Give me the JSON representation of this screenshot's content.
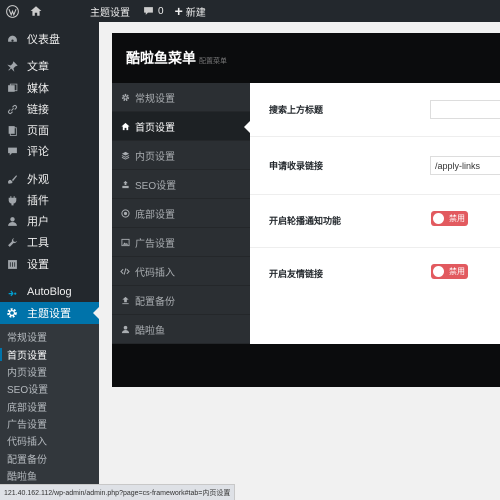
{
  "adminbar": {
    "site_name": "主题设置",
    "comments_count": "0",
    "new_label": "新建"
  },
  "sidebar": {
    "items": [
      {
        "label": "仪表盘",
        "icon": "dashboard-icon"
      },
      {
        "label": "文章",
        "icon": "pin-icon"
      },
      {
        "label": "媒体",
        "icon": "media-icon"
      },
      {
        "label": "链接",
        "icon": "link-icon"
      },
      {
        "label": "页面",
        "icon": "page-icon"
      },
      {
        "label": "评论",
        "icon": "comment-icon"
      },
      {
        "label": "外观",
        "icon": "brush-icon"
      },
      {
        "label": "插件",
        "icon": "plugin-icon"
      },
      {
        "label": "用户",
        "icon": "user-icon"
      },
      {
        "label": "工具",
        "icon": "wrench-icon"
      },
      {
        "label": "设置",
        "icon": "settings-icon"
      },
      {
        "label": "AutoBlog",
        "icon": "autoblog-icon"
      },
      {
        "label": "主题设置",
        "icon": "gear-icon"
      }
    ],
    "submenu": [
      "常规设置",
      "首页设置",
      "内页设置",
      "SEO设置",
      "底部设置",
      "广告设置",
      "代码插入",
      "配置备份",
      "酷啦鱼"
    ]
  },
  "panel": {
    "title": "酷啦鱼菜单",
    "subtitle": "配置菜单",
    "nav": [
      {
        "label": "常规设置",
        "icon": "gear-icon"
      },
      {
        "label": "首页设置",
        "icon": "home-icon"
      },
      {
        "label": "内页设置",
        "icon": "layers-icon"
      },
      {
        "label": "SEO设置",
        "icon": "seo-icon"
      },
      {
        "label": "底部设置",
        "icon": "dot-circle-icon"
      },
      {
        "label": "广告设置",
        "icon": "image-icon"
      },
      {
        "label": "代码插入",
        "icon": "code-icon"
      },
      {
        "label": "配置备份",
        "icon": "backup-icon"
      },
      {
        "label": "酷啦鱼",
        "icon": "user-icon"
      }
    ],
    "fields": {
      "search_title": {
        "label": "搜索上方标题",
        "value": ""
      },
      "apply_link": {
        "label": "申请收录链接",
        "value": "/apply-links"
      },
      "carousel": {
        "label": "开启轮播通知功能",
        "toggle": "禁用"
      },
      "friend_links": {
        "label": "开启友情链接",
        "toggle": "禁用"
      }
    }
  },
  "statusbar": {
    "url": "121.40.162.112/wp-admin/admin.php?page=cs-framework#tab=内页设置"
  },
  "colors": {
    "adminbar_bg": "#23282d",
    "active_blue": "#0073aa",
    "toggle_red": "#e25a5f"
  }
}
